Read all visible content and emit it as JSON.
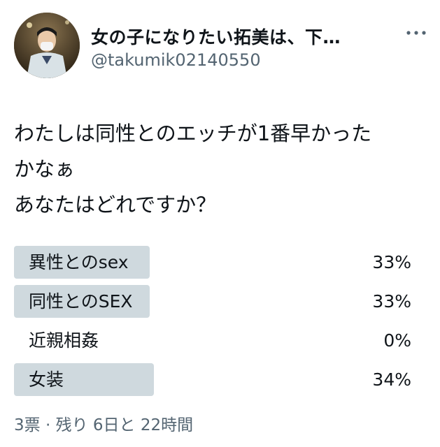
{
  "author": {
    "display_name": "女の子になりたい拓美は、下…",
    "handle": "@takumik02140550"
  },
  "tweet": {
    "lines": [
      "わたしは同性とのエッチが1番早かった",
      "かなぁ",
      "あなたはどれですか？"
    ]
  },
  "poll": {
    "options": [
      {
        "label": "異性とのsex",
        "percent_text": "33%",
        "percent": 33
      },
      {
        "label": "同性とのSEX",
        "percent_text": "33%",
        "percent": 33
      },
      {
        "label": "近親相姦",
        "percent_text": "0%",
        "percent": 0
      },
      {
        "label": "女装",
        "percent_text": "34%",
        "percent": 34
      }
    ],
    "footer": "3票 · 残り 6日と 22時間"
  },
  "colors": {
    "bar": "#cfd9de",
    "secondary_text": "#536471",
    "primary_text": "#0f1419"
  },
  "icons": {
    "more": "more-dots-icon"
  }
}
